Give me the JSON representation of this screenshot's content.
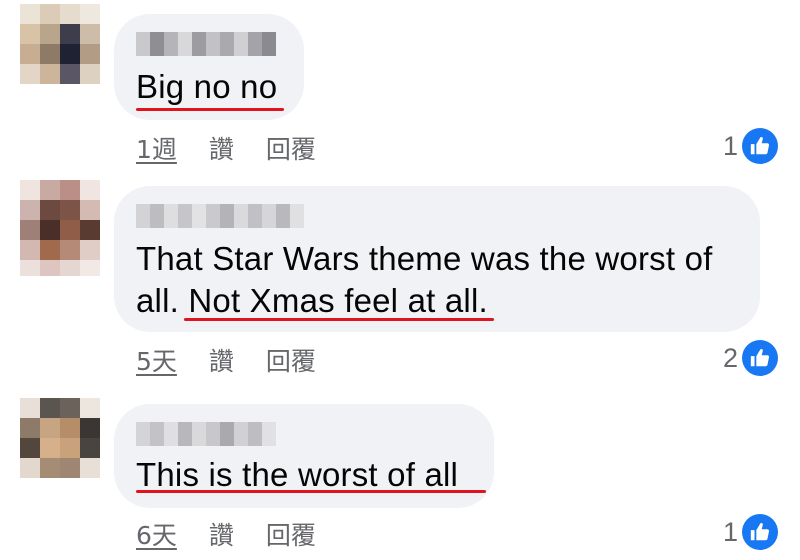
{
  "colors": {
    "bubble": "#f0f2f5",
    "meta_text": "#65676b",
    "underline_mark": "#e0141e",
    "like_badge": "#1877f2"
  },
  "comments": [
    {
      "text": "Big no no",
      "actions": {
        "time": "1週",
        "like": "讚",
        "reply": "回覆"
      },
      "reaction_icon": "thumbs-up-icon",
      "reaction_count": "1"
    },
    {
      "text_lines": [
        "That Star Wars theme was the worst of",
        "all. Not Xmas feel at all."
      ],
      "actions": {
        "time": "5天",
        "like": "讚",
        "reply": "回覆"
      },
      "reaction_icon": "thumbs-up-icon",
      "reaction_count": "2"
    },
    {
      "text": "This is the worst of all",
      "actions": {
        "time": "6天",
        "like": "讚",
        "reply": "回覆"
      },
      "reaction_icon": "thumbs-up-icon",
      "reaction_count": "1"
    }
  ]
}
